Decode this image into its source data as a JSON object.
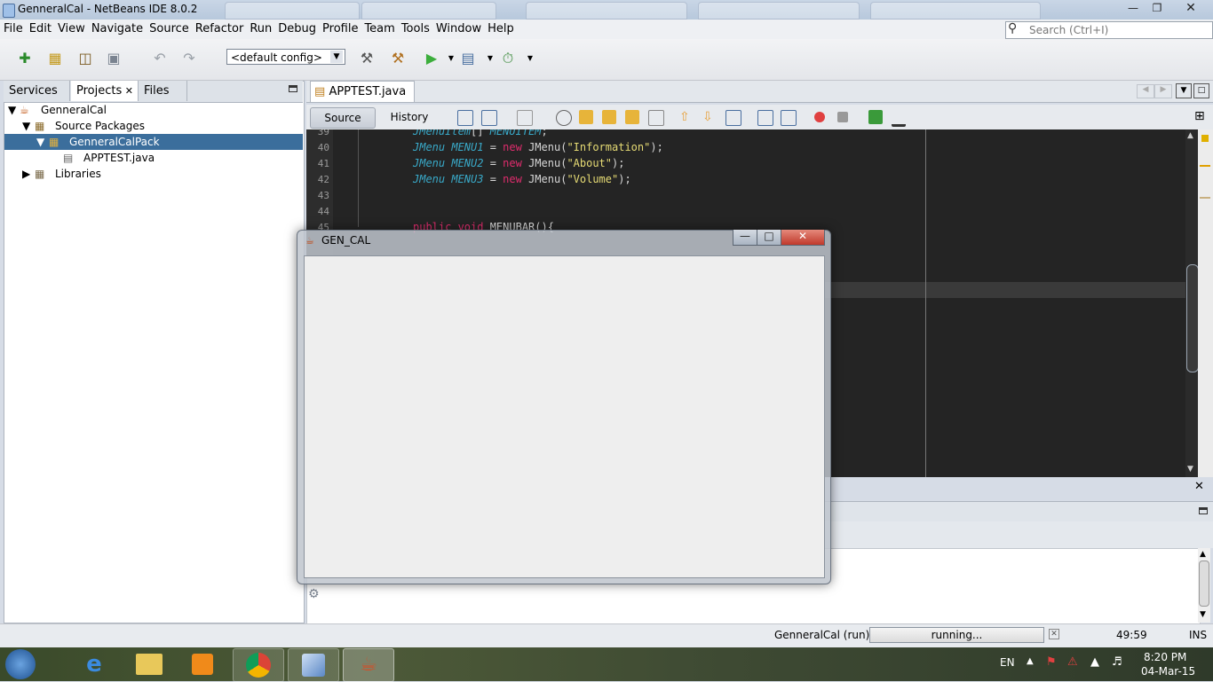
{
  "window": {
    "title": "GenneralCal - NetBeans IDE 8.0.2"
  },
  "menu": [
    "File",
    "Edit",
    "View",
    "Navigate",
    "Source",
    "Refactor",
    "Run",
    "Debug",
    "Profile",
    "Team",
    "Tools",
    "Window",
    "Help"
  ],
  "search": {
    "placeholder": "Search (Ctrl+I)"
  },
  "toolbar": {
    "config": "<default config>"
  },
  "left_tabs": [
    "Services",
    "Projects",
    "Files"
  ],
  "tree": {
    "project": "GenneralCal",
    "source_packages": "Source Packages",
    "package": "GenneralCalPack",
    "file": "APPTEST.java",
    "libraries": "Libraries"
  },
  "editor": {
    "tab": "APPTEST.java",
    "source_btn": "Source",
    "history_btn": "History",
    "lines": [
      {
        "n": "39",
        "parts": [
          [
            "ty",
            "JMenuItem"
          ],
          [
            "",
            "[] "
          ],
          [
            "ty",
            "MENUITEM"
          ],
          [
            "",
            ";"
          ]
        ]
      },
      {
        "n": "40",
        "parts": [
          [
            "ty",
            "JMenu "
          ],
          [
            "ty",
            "MENU1"
          ],
          [
            "",
            " = "
          ],
          [
            "kw",
            "new"
          ],
          [
            "",
            " JMenu("
          ],
          [
            "str",
            "\"Information\""
          ],
          [
            "",
            ");"
          ]
        ]
      },
      {
        "n": "41",
        "parts": [
          [
            "ty",
            "JMenu "
          ],
          [
            "ty",
            "MENU2"
          ],
          [
            "",
            " = "
          ],
          [
            "kw",
            "new"
          ],
          [
            "",
            " JMenu("
          ],
          [
            "str",
            "\"About\""
          ],
          [
            "",
            ");"
          ]
        ]
      },
      {
        "n": "42",
        "parts": [
          [
            "ty",
            "JMenu "
          ],
          [
            "ty",
            "MENU3"
          ],
          [
            "",
            " = "
          ],
          [
            "kw",
            "new"
          ],
          [
            "",
            " JMenu("
          ],
          [
            "str",
            "\"Volume\""
          ],
          [
            "",
            ");"
          ]
        ]
      },
      {
        "n": "43",
        "parts": []
      },
      {
        "n": "44",
        "parts": []
      },
      {
        "n": "45",
        "parts": [
          [
            "kw",
            "public void "
          ],
          [
            "",
            "MENUBAR(){"
          ]
        ]
      }
    ]
  },
  "java_window": {
    "title": "GEN_CAL"
  },
  "status": {
    "task": "GenneralCal (run)",
    "progress": "running...",
    "position": "49:59",
    "mode": "INS"
  },
  "tray": {
    "lang": "EN",
    "time": "8:20 PM",
    "date": "04-Mar-15"
  },
  "colors": {
    "selection": "#3b6e9c",
    "editor_bg": "#242424"
  }
}
